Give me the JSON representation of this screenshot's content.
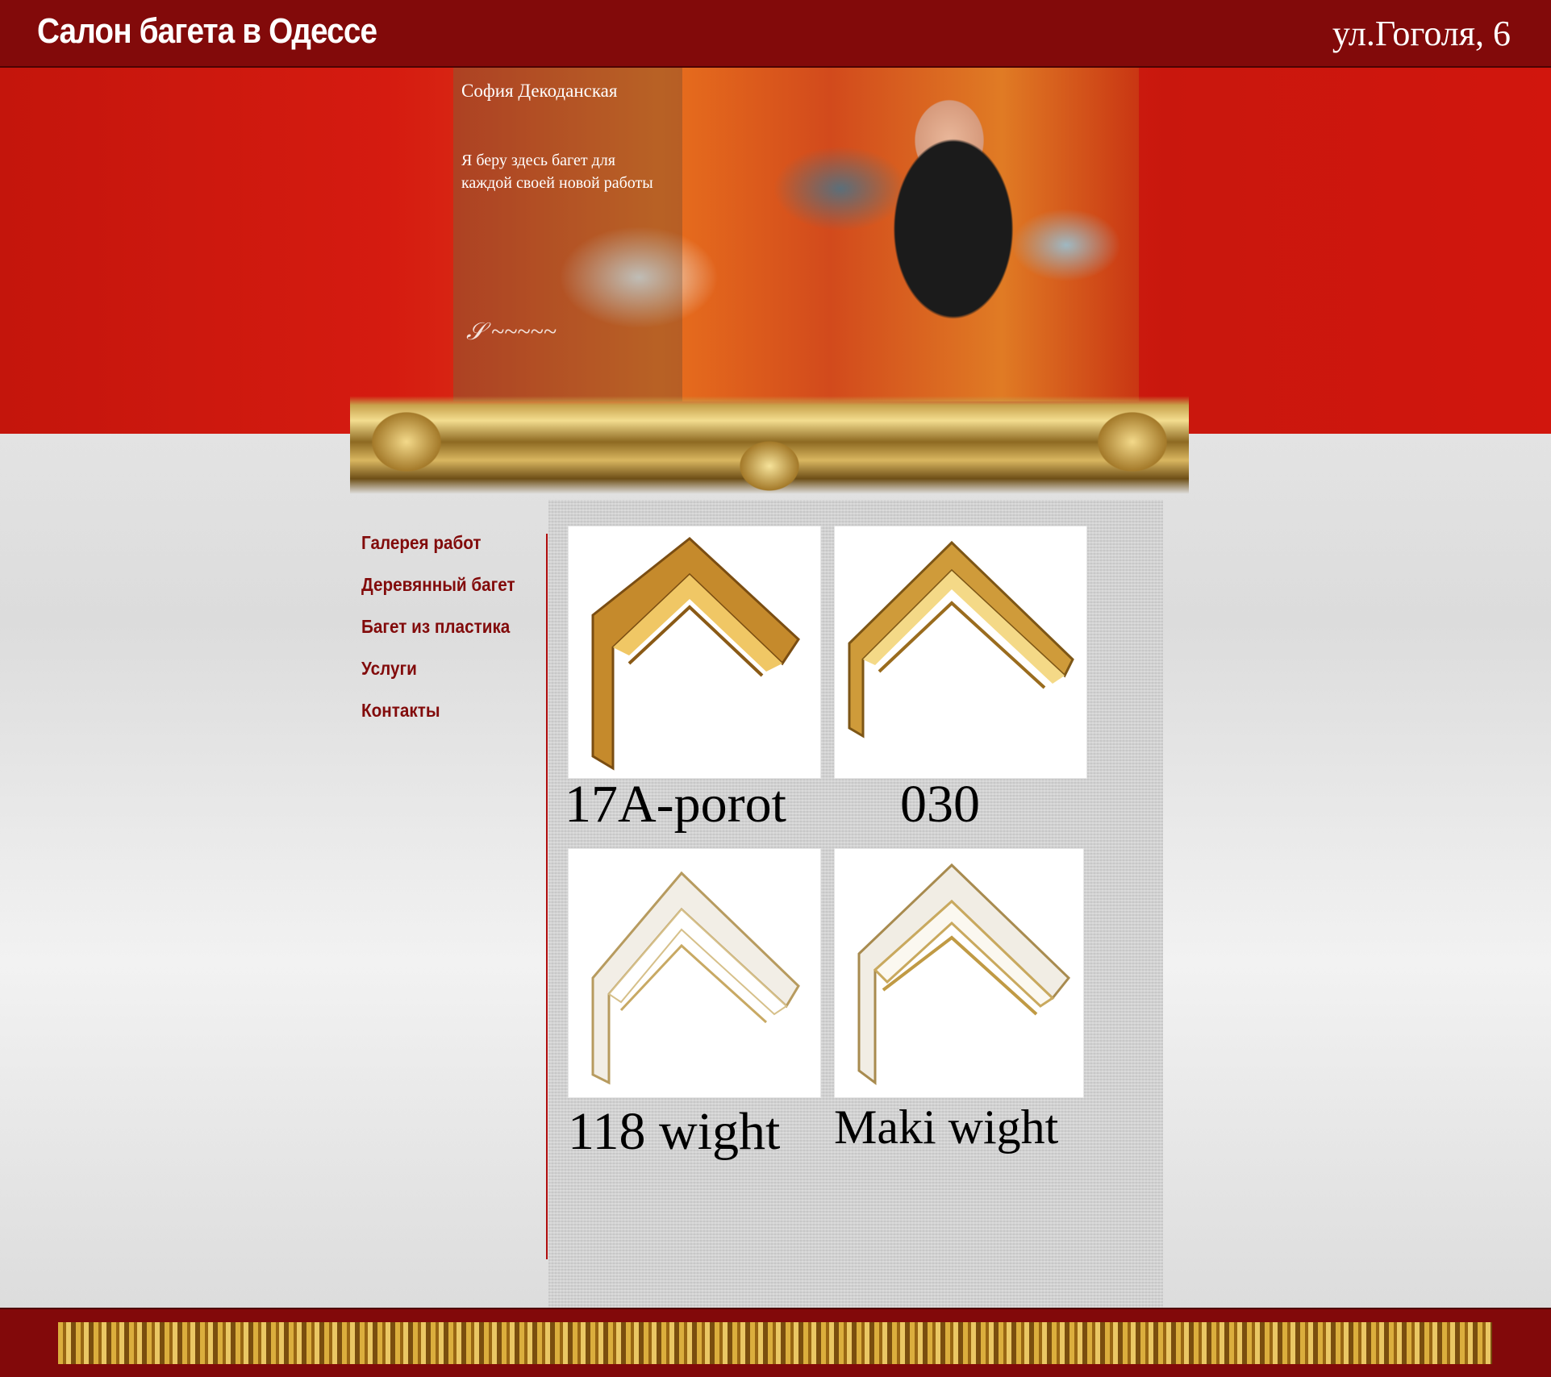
{
  "header": {
    "title": "Салон багета в Одессе",
    "address": "ул.Гоголя, 6"
  },
  "hero": {
    "quote_author": "София Декоданская",
    "quote_text": "Я беру здесь багет для каждой своей новой работы"
  },
  "nav": {
    "items": [
      {
        "label": "Галерея работ"
      },
      {
        "label": "Деревянный багет"
      },
      {
        "label": "Багет из пластика"
      },
      {
        "label": "Услуги"
      },
      {
        "label": "Контакты"
      }
    ]
  },
  "products": [
    {
      "caption": "17A-porot",
      "color": "#c58a2c"
    },
    {
      "caption": "030",
      "color": "#cf9b3a"
    },
    {
      "caption": "118 wight",
      "color": "#f2eee6"
    },
    {
      "caption": "Maki wight",
      "color": "#f1ede4"
    }
  ],
  "colors": {
    "header_bg": "#820a0a",
    "hero_red": "#d51b10",
    "nav_text": "#820b0b",
    "footer_bg": "#82090a",
    "gold": "#c8a24c"
  }
}
